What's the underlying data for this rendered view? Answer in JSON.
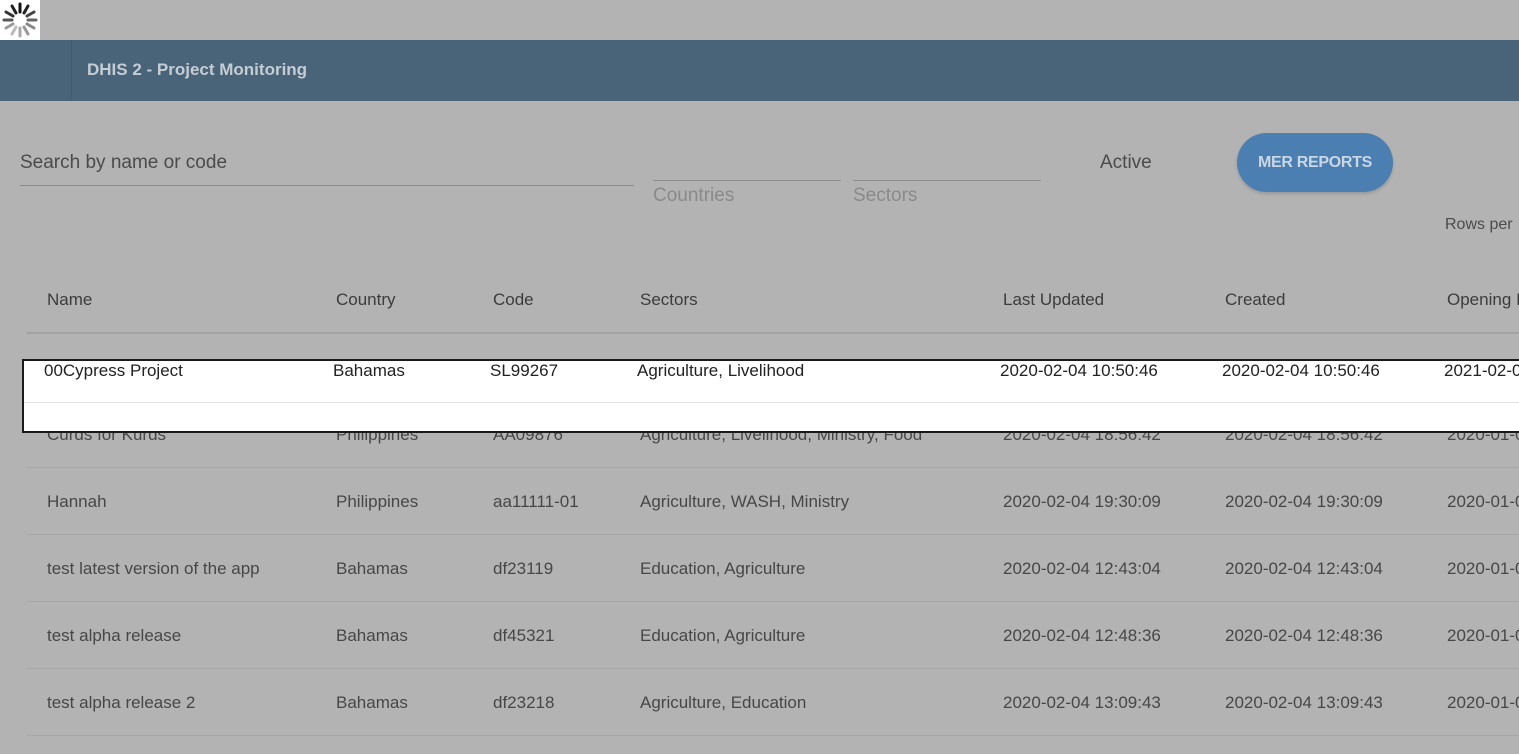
{
  "header": {
    "title": "DHIS 2 - Project Monitoring"
  },
  "filters": {
    "search_placeholder": "Search by name or code",
    "countries_label": "Countries",
    "sectors_label": "Sectors",
    "active_label": "Active",
    "mer_reports_label": "MER REPORTS",
    "rows_per_page_label": "Rows per"
  },
  "table": {
    "columns": [
      "Name",
      "Country",
      "Code",
      "Sectors",
      "Last Updated",
      "Created",
      "Opening I"
    ],
    "rows": [
      {
        "name": "00Cypress Project",
        "country": "Bahamas",
        "code": "SL99267",
        "sectors": "Agriculture, Livelihood",
        "last_updated": "2020-02-04 10:50:46",
        "created": "2020-02-04 10:50:46",
        "opening": "2021-02-0"
      },
      {
        "name": "Curds for Kurds",
        "country": "Philippines",
        "code": "AA09876",
        "sectors": "Agriculture, Livelihood, Ministry, Food",
        "last_updated": "2020-02-04 18:56:42",
        "created": "2020-02-04 18:56:42",
        "opening": "2020-01-0"
      },
      {
        "name": "Hannah",
        "country": "Philippines",
        "code": "aa11111-01",
        "sectors": "Agriculture, WASH, Ministry",
        "last_updated": "2020-02-04 19:30:09",
        "created": "2020-02-04 19:30:09",
        "opening": "2020-01-0"
      },
      {
        "name": "test latest version of the app",
        "country": "Bahamas",
        "code": "df23119",
        "sectors": "Education, Agriculture",
        "last_updated": "2020-02-04 12:43:04",
        "created": "2020-02-04 12:43:04",
        "opening": "2020-01-0"
      },
      {
        "name": "test alpha release",
        "country": "Bahamas",
        "code": "df45321",
        "sectors": "Education, Agriculture",
        "last_updated": "2020-02-04 12:48:36",
        "created": "2020-02-04 12:48:36",
        "opening": "2020-01-0"
      },
      {
        "name": "test alpha release 2",
        "country": "Bahamas",
        "code": "df23218",
        "sectors": "Agriculture, Education",
        "last_updated": "2020-02-04 13:09:43",
        "created": "2020-02-04 13:09:43",
        "opening": "2020-01-0"
      }
    ]
  },
  "colors": {
    "overlay": "#b3b3b3",
    "header": "#496379",
    "button": "#4c7fb1",
    "highlight_row": "#ffffff"
  }
}
